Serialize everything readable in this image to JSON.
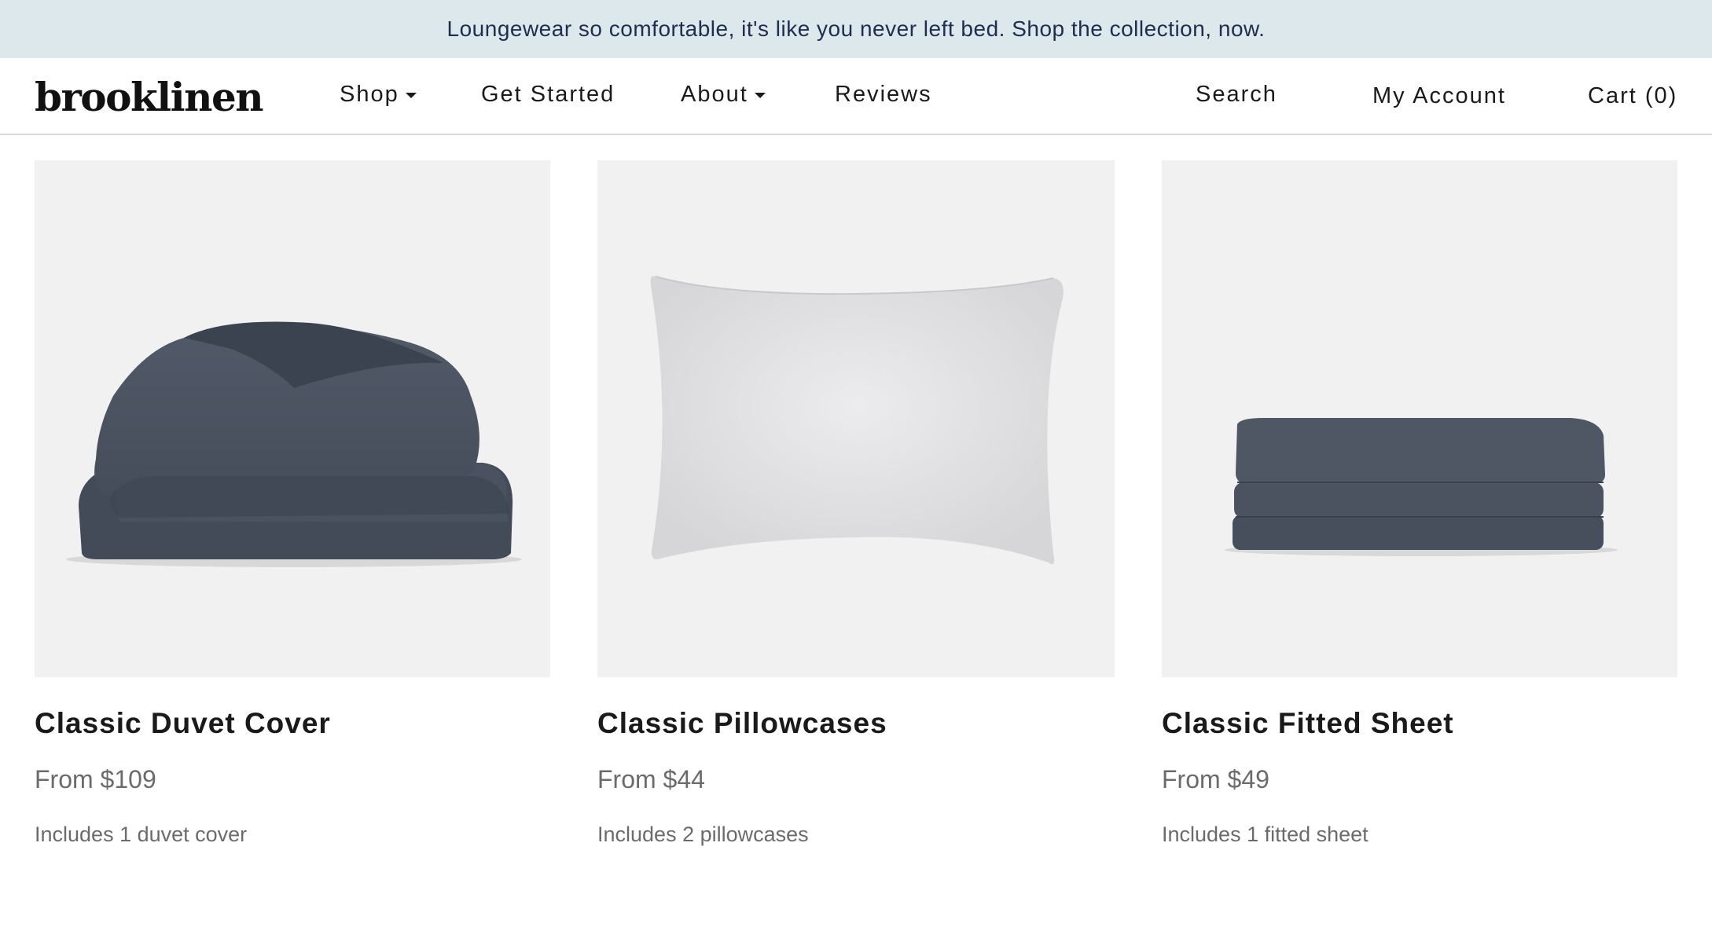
{
  "announcement": "Loungewear so comfortable, it's like you never left bed. Shop the collection, now.",
  "header": {
    "logo": "brooklinen",
    "nav": {
      "shop": "Shop",
      "get_started": "Get Started",
      "about": "About",
      "reviews": "Reviews"
    },
    "utility": {
      "search": "Search",
      "account": "My Account",
      "cart": "Cart (0)"
    }
  },
  "products": [
    {
      "title": "Classic Duvet Cover",
      "price": "From $109",
      "description": "Includes 1 duvet cover",
      "image": "folded-duvet-cover-charcoal"
    },
    {
      "title": "Classic Pillowcases",
      "price": "From $44",
      "description": "Includes 2 pillowcases",
      "image": "white-pillowcase"
    },
    {
      "title": "Classic Fitted Sheet",
      "price": "From $49",
      "description": "Includes 1 fitted sheet",
      "image": "folded-fitted-sheet-charcoal"
    }
  ],
  "colors": {
    "announcement_bg": "#dde8ec",
    "announcement_text": "#1f2d4e",
    "product_image_bg": "#f1f1f1",
    "fabric_charcoal": "#4b5261",
    "fabric_white": "#e6e6e8"
  }
}
